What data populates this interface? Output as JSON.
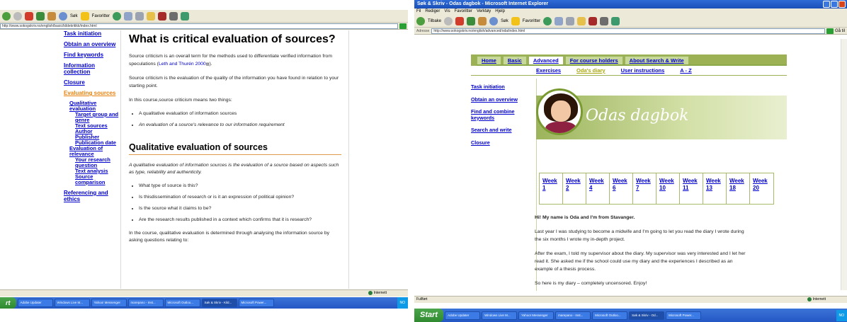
{
  "left": {
    "toolbar": {
      "search_label": "Søk",
      "favorites_label": "Favoritter"
    },
    "address": "http://www.sokogskriv.no/english/basic/kildekritikk/index.html",
    "nav": [
      {
        "label": "Task initiation",
        "level": 0
      },
      {
        "label": "Obtain an overview",
        "level": 0
      },
      {
        "label": "Find keywords",
        "level": 0
      },
      {
        "label": "Information collection",
        "level": 0
      },
      {
        "label": "Closure",
        "level": 0
      },
      {
        "label": "Evaluating sources",
        "level": 0,
        "current": true
      },
      {
        "label": "Qualitative evaluation",
        "level": 1
      },
      {
        "label": "Target group and genre",
        "level": 2
      },
      {
        "label": "Text sources",
        "level": 2
      },
      {
        "label": "Author",
        "level": 2
      },
      {
        "label": "Publisher",
        "level": 2
      },
      {
        "label": "Publication date",
        "level": 2
      },
      {
        "label": "Evaluation of relevance",
        "level": 1
      },
      {
        "label": "Your research question",
        "level": 2
      },
      {
        "label": "Text analysis",
        "level": 2
      },
      {
        "label": "Source comparison",
        "level": 2
      },
      {
        "label": "Referencing and ethics",
        "level": 0
      }
    ],
    "title": "What is critical evaluation of sources?",
    "p1_pre": "Source criticism is an overall term for the methods used to differentiate verified information from speculations (",
    "p1_link": "Leth and Thurén 2000",
    "p1_post": ").",
    "p2": "Source criticism is the evaluation of the quality of the information you have found in relation to your starting point.",
    "p3": "In this course,source criticism means two things:",
    "list1": [
      "A qualitative evaluation of information sources",
      "An evaluation of a source's relevance to our information requirement"
    ],
    "h2": "Qualitative evaluation of sources",
    "p4": "A qualitative evaluation of information sources is the evaluation of a source based on aspects such as type, reliability and authenticity.",
    "list2": [
      "What type of source is this?",
      "Is thisdissemination of research or is it an expression of political opinion?",
      "Is the source what it claims to be?",
      "Are the research results published in a context which confirms that it is research?"
    ],
    "p5": "In the course, qualitative evaluation is determined through analysing the information source by asking questions relating to:",
    "zone": "Internett",
    "taskbar": [
      "Adobe Updater",
      "Windows Live M...",
      "Yahoo! Messenger",
      "marepano - Inst...",
      "Microsoft Outloo...",
      "Søk & Skriv - Kild...",
      "Microsoft Power..."
    ],
    "start": "rt",
    "tray": "NO"
  },
  "right": {
    "window_title": "Søk & Skriv - Odas dagbok - Microsoft Internet Explorer",
    "menu": [
      "Fil",
      "Rediger",
      "Vis",
      "Favoritter",
      "Verktøy",
      "Hjelp"
    ],
    "toolbar": {
      "back_label": "Tilbake",
      "search_label": "Søk",
      "favorites_label": "Favoritter"
    },
    "address_label": "Adresse",
    "address": "http://www.sokogskriv.no/english/advanced/oda/index.html",
    "go_label": "Gå til",
    "tabs": [
      "Home",
      "Basic",
      "Advanced",
      "For course holders",
      "About Search & Write"
    ],
    "subnav": [
      "Exercises",
      "Oda's diary",
      "User instructions",
      "A - Z"
    ],
    "nav": [
      "Task initiation",
      "Obtain an overview",
      "Find and combine keywords",
      "Search and write",
      "Closure"
    ],
    "banner_title": "Odas dagbok",
    "weeks": [
      {
        "label": "Week",
        "num": "1"
      },
      {
        "label": "Week",
        "num": "2"
      },
      {
        "label": "Week",
        "num": "4"
      },
      {
        "label": "Week",
        "num": "6"
      },
      {
        "label": "Week",
        "num": "7"
      },
      {
        "label": "Week",
        "num": "10"
      },
      {
        "label": "Week",
        "num": "11"
      },
      {
        "label": "Week",
        "num": "13"
      },
      {
        "label": "Week",
        "num": "18"
      },
      {
        "label": "Week",
        "num": "20"
      }
    ],
    "intro": "Hi! My name is Oda and I'm from Stavanger.",
    "p1": "Last year I was studying to become a midwife and I'm going to let you read the diary I wrote during the six months I wrote my in-depth project.",
    "p2": "After the exam, I told my supervisor about the diary. My supervisor was very interested and I let her read it. She asked me if the school could use my diary and the experiences I described as an example of a thesis process.",
    "p3": "So here is my diary – completely uncensored. Enjoy!",
    "status": "Fullført",
    "zone": "Internett",
    "start": "Start",
    "taskbar": [
      "Adobe Updater",
      "Windows Live M...",
      "Yahoo! Messenger",
      "marepano - Inst...",
      "Microsoft Outloo...",
      "Søk & Skriv - Od...",
      "Microsoft Power..."
    ],
    "tray": "NO"
  }
}
